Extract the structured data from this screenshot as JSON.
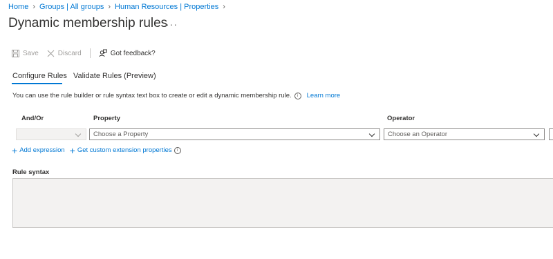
{
  "breadcrumb": [
    {
      "label": "Home"
    },
    {
      "label": "Groups | All groups"
    },
    {
      "label": "Human Resources | Properties"
    }
  ],
  "page": {
    "title": "Dynamic membership rules",
    "more_label": "···"
  },
  "toolbar": {
    "save_label": "Save",
    "discard_label": "Discard",
    "feedback_label": "Got feedback?"
  },
  "tabs": [
    {
      "label": "Configure Rules",
      "active": true
    },
    {
      "label": "Validate Rules (Preview)",
      "active": false
    }
  ],
  "description": {
    "text": "You can use the rule builder or rule syntax text box to create or edit a dynamic membership rule.",
    "info_icon_glyph": "i",
    "link_label": "Learn more"
  },
  "rule_table": {
    "headers": {
      "and_or": "And/Or",
      "property": "Property",
      "operator": "Operator"
    },
    "row": {
      "and_or_value": "",
      "property_placeholder": "Choose a Property",
      "operator_placeholder": "Choose an Operator"
    }
  },
  "actions": {
    "add_expression": "Add expression",
    "get_custom_extension": "Get custom extension properties",
    "info_icon_glyph": "i"
  },
  "rule_syntax": {
    "label": "Rule syntax",
    "value": ""
  },
  "colors": {
    "accent": "#0078d4",
    "text": "#323130",
    "disabled_text": "#a19f9d",
    "syntax_bg": "#f3f2f1"
  },
  "icons": {
    "save": "save-icon",
    "discard": "close-icon",
    "feedback": "feedback-person-icon",
    "chevron": "chevron-down-icon",
    "add": "plus-icon",
    "info": "info-icon"
  }
}
